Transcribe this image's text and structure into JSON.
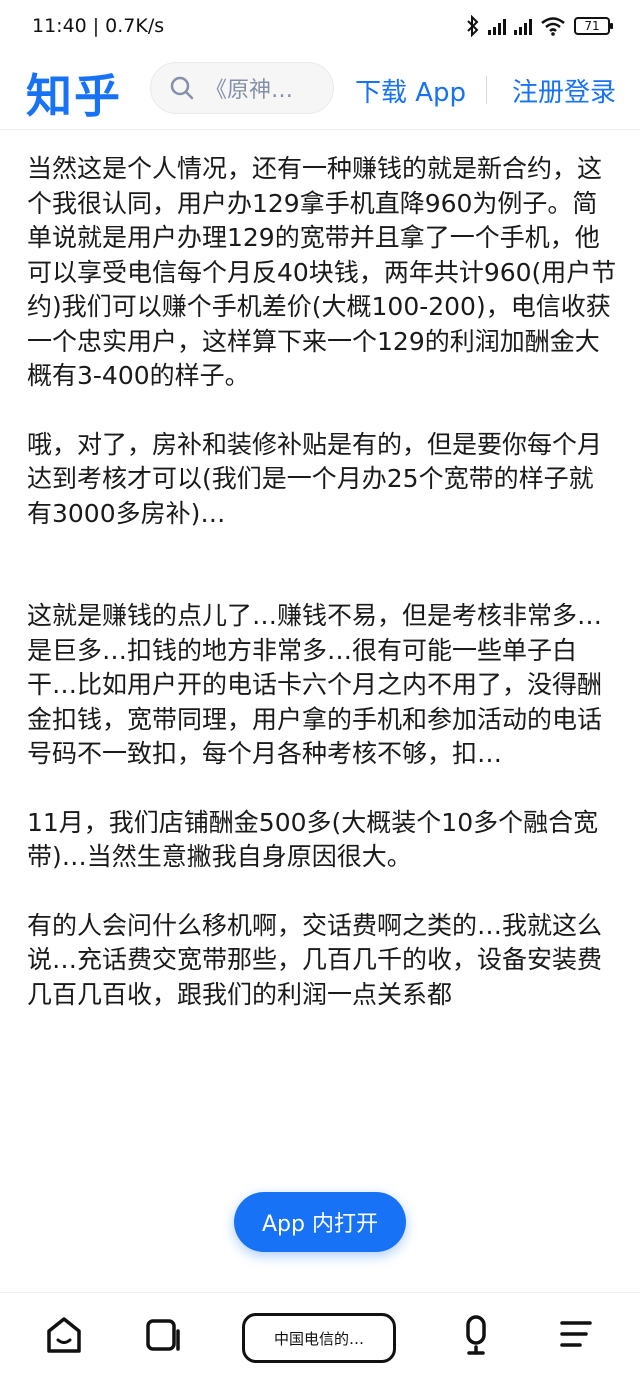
{
  "status": {
    "time": "11:40",
    "speed": "0.7K/s",
    "battery": "71"
  },
  "header": {
    "logo": "知乎",
    "search_placeholder": "《原神…",
    "download_label": "下载 App",
    "login_label": "注册登录"
  },
  "article": {
    "paragraphs": [
      "当然这是个人情况，还有一种赚钱的就是新合约，这个我很认同，用户办129拿手机直降960为例子。简单说就是用户办理129的宽带并且拿了一个手机，他可以享受电信每个月反40块钱，两年共计960(用户节约)我们可以赚个手机差价(大概100-200)，电信收获一个忠实用户，这样算下来一个129的利润加酬金大概有3-400的样子。",
      "哦，对了，房补和装修补贴是有的，但是要你每个月达到考核才可以(我们是一个月办25个宽带的样子就有3000多房补)…",
      "这就是赚钱的点儿了…赚钱不易，但是考核非常多…是巨多…扣钱的地方非常多…很有可能一些单子白干…比如用户开的电话卡六个月之内不用了，没得酬金扣钱，宽带同理，用户拿的手机和参加活动的电话号码不一致扣，每个月各种考核不够，扣…",
      "11月，我们店铺酬金500多(大概装个10多个融合宽带)…当然生意撇我自身原因很大。",
      "有的人会问什么移机啊，交话费啊之类的…我就这么说…充话费交宽带那些，几百几千的收，设备安装费几百几百收，跟我们的利润一点关系都"
    ]
  },
  "open_app_label": "App 内打开",
  "bottom_nav": {
    "address_label": "中国电信的…"
  },
  "colors": {
    "brand": "#1772f6"
  }
}
